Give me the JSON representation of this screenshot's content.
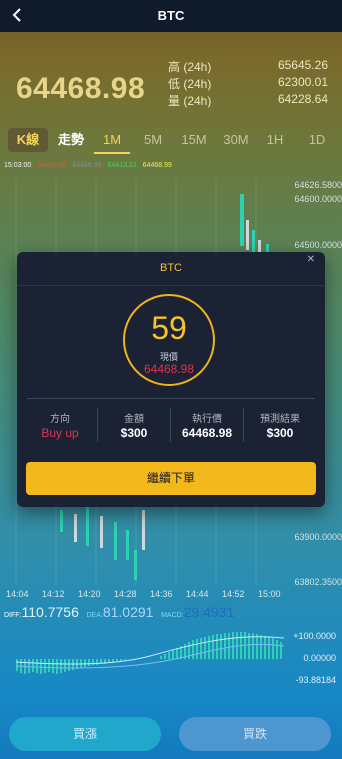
{
  "header": {
    "title": "BTC",
    "back_icon": "chevron-left-icon"
  },
  "price": "64468.98",
  "stats": [
    {
      "label": "高 (24h)",
      "value": "65645.26"
    },
    {
      "label": "低 (24h)",
      "value": "62300.01"
    },
    {
      "label": "量 (24h)",
      "value": "64228.64"
    }
  ],
  "tabs": {
    "kline": "K線",
    "trend": "走勢",
    "intervals": [
      "1M",
      "5M",
      "15M",
      "30M",
      "1H",
      "1D"
    ],
    "active": "1M"
  },
  "indicator_line": [
    {
      "text": "15:03:00",
      "color": "#f1f1f1"
    },
    {
      "text": "64469.98",
      "color": "#d8593a"
    },
    {
      "text": "64468.98",
      "color": "#8a8a8a"
    },
    {
      "text": "64413.21",
      "color": "#4ccf5d"
    },
    {
      "text": "64468.99",
      "color": "#f3e94a"
    }
  ],
  "price_axis": [
    "64626.5800",
    "64600.0000",
    "64500.0000",
    "63900.0000",
    "63802.3500"
  ],
  "time_axis": [
    "14:04",
    "14:12",
    "14:20",
    "14:28",
    "14:36",
    "14:44",
    "14:52",
    "15:00"
  ],
  "macd": {
    "diff_label": "DIFF:",
    "diff_value": "110.7756",
    "dea_label": "DEA:",
    "dea_value": "81.0291",
    "macd_label": "MACD:",
    "macd_value": "29.4931",
    "axis": [
      "+100.0000",
      "0.00000",
      "-93.88184"
    ]
  },
  "modal": {
    "title": "BTC",
    "close_icon": "close-icon",
    "countdown": "59",
    "current_label": "現價",
    "current_value": "64468.98",
    "fields": [
      {
        "label": "方向",
        "value": "Buy up"
      },
      {
        "label": "金額",
        "value": "$300"
      },
      {
        "label": "執行價",
        "value": "64468.98"
      },
      {
        "label": "預測結果",
        "value": "$300"
      }
    ],
    "continue_label": "繼續下單"
  },
  "buttons": {
    "buy": "買漲",
    "sell": "買跌"
  },
  "colors": {
    "accent_gold": "#f2b81c",
    "up_red": "#e0344c",
    "candle_up": "#2fd1b3",
    "candle_down": "#cfd8dc"
  }
}
